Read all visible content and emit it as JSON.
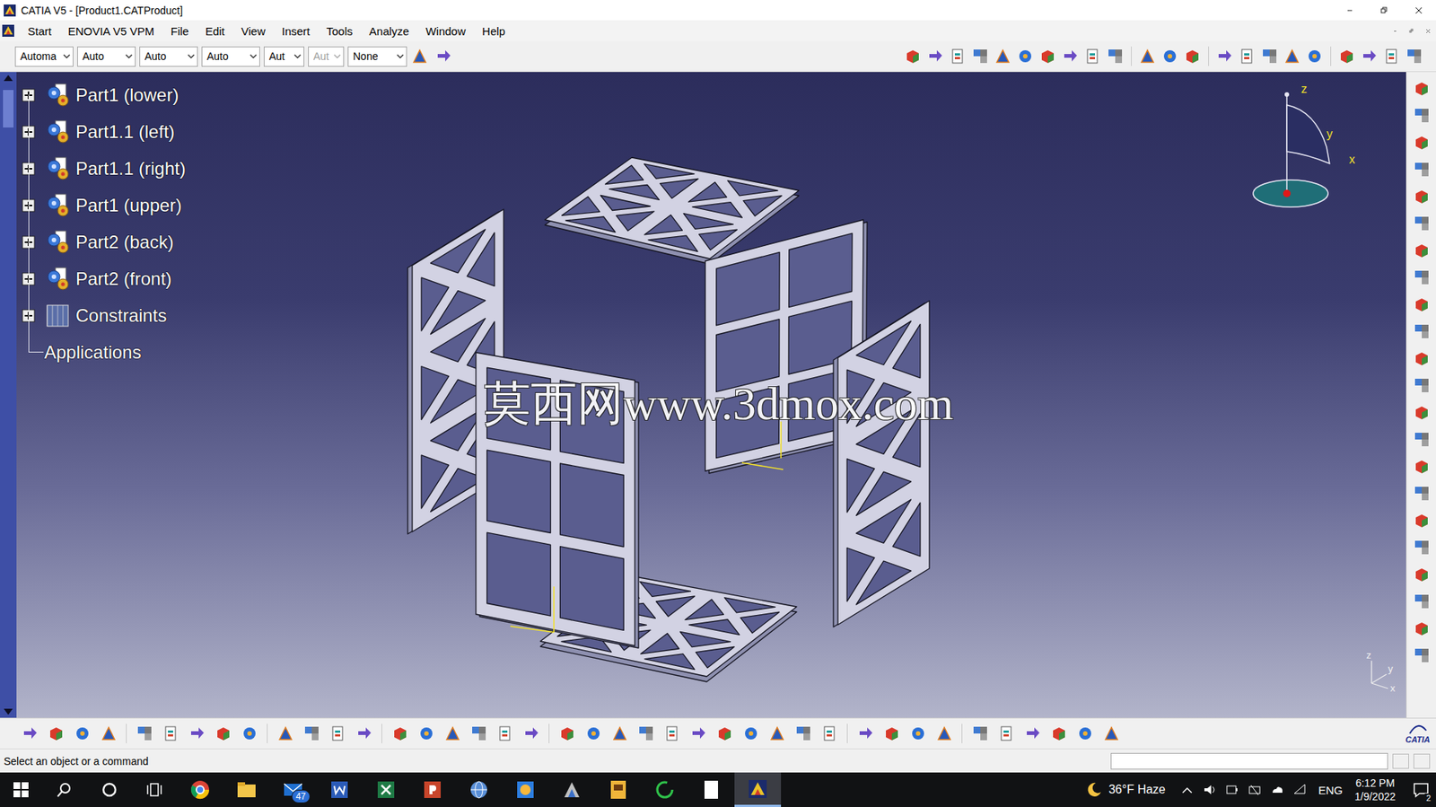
{
  "window": {
    "title": "CATIA V5 - [Product1.CATProduct]"
  },
  "menu": [
    "Start",
    "ENOVIA V5 VPM",
    "File",
    "Edit",
    "View",
    "Insert",
    "Tools",
    "Analyze",
    "Window",
    "Help"
  ],
  "toolbar_fields": [
    {
      "value": "Automa",
      "disabled": false
    },
    {
      "value": "Auto",
      "disabled": false
    },
    {
      "value": "Auto",
      "disabled": false
    },
    {
      "value": "Auto",
      "disabled": false
    },
    {
      "value": "Aut",
      "disabled": false
    },
    {
      "value": "Aut",
      "disabled": true
    },
    {
      "value": "None",
      "disabled": false
    }
  ],
  "tree": {
    "items": [
      {
        "label": "Part1 (lower)",
        "kind": "part",
        "expanded": false
      },
      {
        "label": "Part1.1 (left)",
        "kind": "part",
        "expanded": false
      },
      {
        "label": "Part1.1 (right)",
        "kind": "part",
        "expanded": false
      },
      {
        "label": "Part1 (upper)",
        "kind": "part",
        "expanded": false
      },
      {
        "label": "Part2 (back)",
        "kind": "part",
        "expanded": false
      },
      {
        "label": "Part2 (front)",
        "kind": "part",
        "expanded": false
      },
      {
        "label": "Constraints",
        "kind": "constraints",
        "expanded": false
      },
      {
        "label": "Applications",
        "kind": "leaf"
      }
    ]
  },
  "compass": {
    "labels": [
      "z",
      "y",
      "x"
    ]
  },
  "axis_triad": {
    "labels": [
      "z",
      "y",
      "x"
    ]
  },
  "watermark": "莫西网www.3dmox.com",
  "logo": "CATIA",
  "status_bar": {
    "message": "Select an object or a command"
  },
  "taskbar": {
    "apps": [
      {
        "kind": "chrome",
        "active": false
      },
      {
        "kind": "explorer",
        "active": false
      },
      {
        "kind": "mail",
        "active": false,
        "badge": "47"
      },
      {
        "kind": "word",
        "active": false
      },
      {
        "kind": "excel",
        "active": false
      },
      {
        "kind": "powerpoint",
        "active": false
      },
      {
        "kind": "browser",
        "active": false
      },
      {
        "kind": "photos",
        "active": false
      },
      {
        "kind": "app",
        "active": false
      },
      {
        "kind": "wb",
        "active": false
      },
      {
        "kind": "refresh",
        "active": false
      },
      {
        "kind": "notepad",
        "active": false
      },
      {
        "kind": "catia",
        "active": true
      }
    ],
    "weather": "36°F Haze",
    "language": "ENG",
    "time": "6:12 PM",
    "date": "1/9/2022",
    "notifications": "2"
  }
}
